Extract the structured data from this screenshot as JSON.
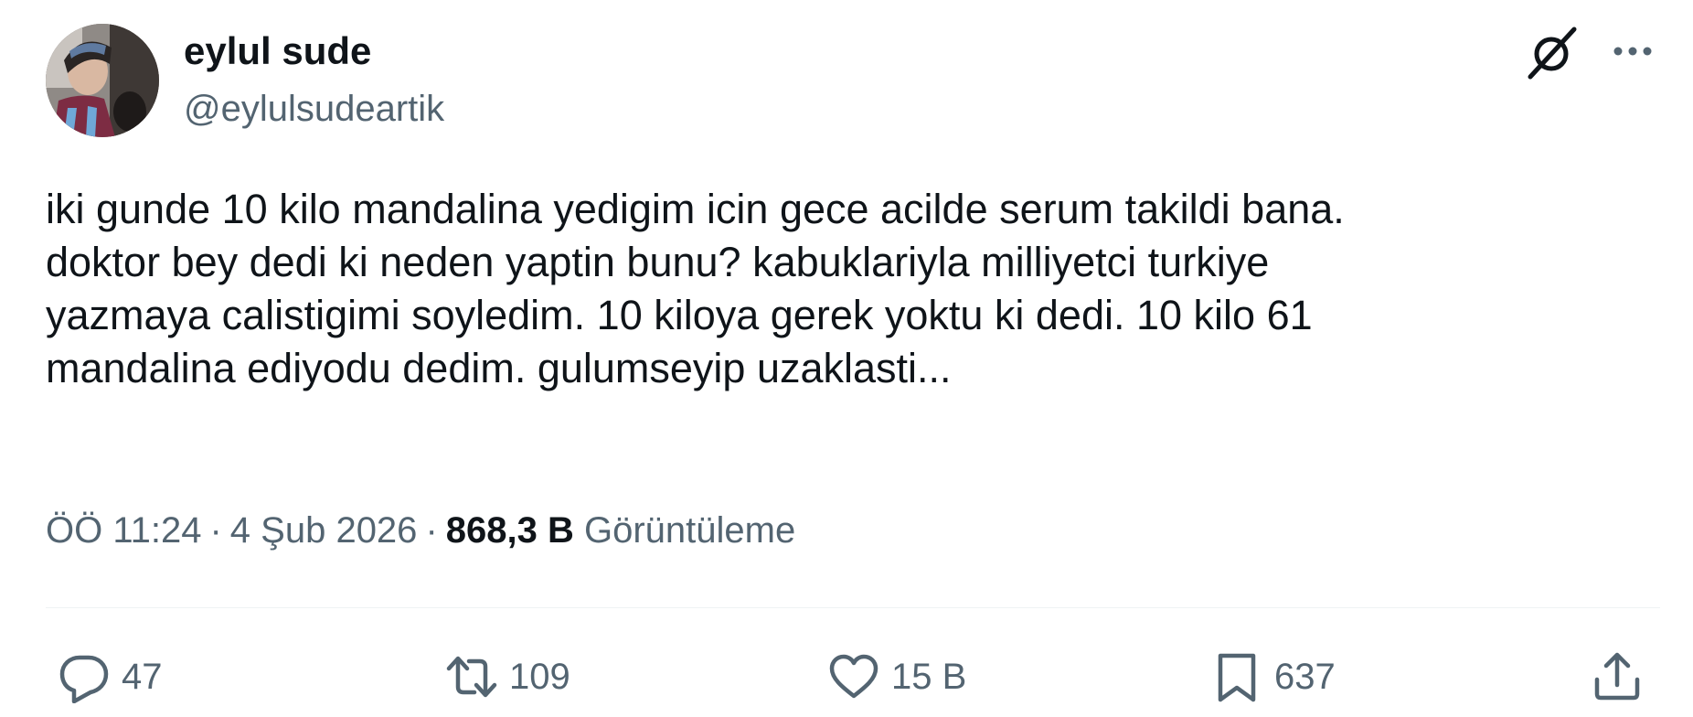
{
  "author": {
    "display_name": "eylul sude",
    "handle": "@eylulsudeartik"
  },
  "header": {
    "grok_icon": "grok-icon",
    "more_icon": "more-dots-icon"
  },
  "tweet": {
    "text": "iki gunde 10 kilo mandalina yedigim icin gece acilde serum takildi bana.\ndoktor bey dedi ki neden yaptin bunu? kabuklariyla milliyetci turkiye\nyazmaya calistigimi soyledim. 10 kiloya gerek yoktu ki dedi. 10 kilo 61\nmandalina ediyodu dedim. gulumseyip uzaklasti..."
  },
  "meta": {
    "time": "ÖÖ 11:24",
    "date": "4 Şub 2026",
    "views_count": "868,3 B",
    "views_label": "Görüntüleme",
    "separator": "·"
  },
  "actions": {
    "reply": {
      "icon": "reply-icon",
      "count": "47"
    },
    "retweet": {
      "icon": "retweet-icon",
      "count": "109"
    },
    "like": {
      "icon": "heart-icon",
      "count": "15 B"
    },
    "bookmark": {
      "icon": "bookmark-icon",
      "count": "637"
    },
    "share": {
      "icon": "share-icon"
    }
  },
  "colors": {
    "text_primary": "#0f1419",
    "text_secondary": "#536471",
    "divider": "#eff3f4",
    "background": "#ffffff"
  }
}
